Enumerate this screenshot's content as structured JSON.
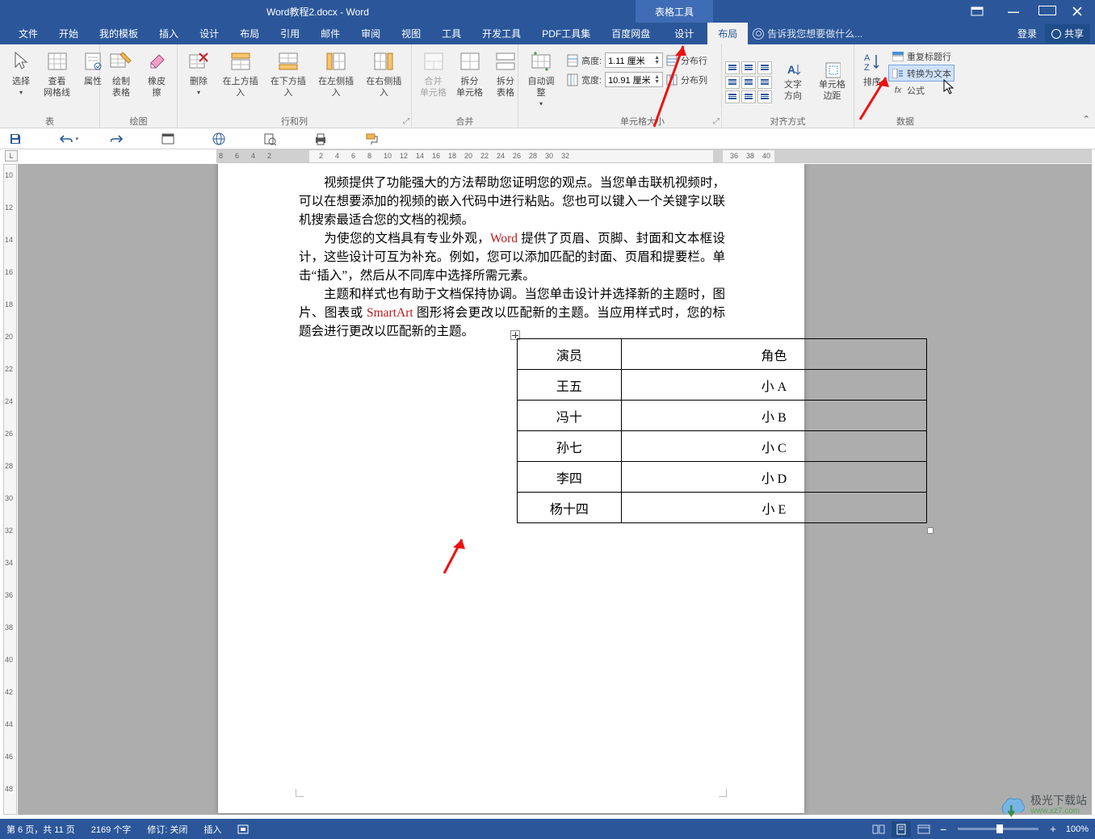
{
  "title_bar": {
    "doc_title": "Word教程2.docx - Word",
    "table_tools": "表格工具"
  },
  "tabs": {
    "items": [
      "文件",
      "开始",
      "我的模板",
      "插入",
      "设计",
      "布局",
      "引用",
      "邮件",
      "审阅",
      "视图",
      "工具",
      "开发工具",
      "PDF工具集",
      "百度网盘",
      "设计",
      "布局"
    ],
    "tellme": "告诉我您想要做什么...",
    "login": "登录",
    "share": "共享"
  },
  "ribbon": {
    "groups": {
      "table": {
        "label": "表",
        "select": "选择",
        "gridlines": "查看\n网格线",
        "props": "属性"
      },
      "draw": {
        "label": "绘图",
        "draw": "绘制表格",
        "eraser": "橡皮擦"
      },
      "rowscols": {
        "label": "行和列",
        "delete": "删除",
        "above": "在上方插入",
        "below": "在下方插入",
        "left": "在左侧插入",
        "right": "在右侧插入"
      },
      "merge": {
        "label": "合并",
        "mergec": "合并\n单元格",
        "splitc": "拆分\n单元格",
        "splitt": "拆分表格"
      },
      "autofit": {
        "label": "",
        "auto": "自动调整"
      },
      "cellsize": {
        "label": "单元格大小",
        "hlabel": "高度:",
        "hval": "1.11 厘米",
        "wlabel": "宽度:",
        "wval": "10.91 厘米",
        "distrows": "分布行",
        "distcols": "分布列"
      },
      "align": {
        "label": "对齐方式",
        "textdir": "文字方向",
        "margins": "单元格\n边距"
      },
      "data": {
        "label": "数据",
        "sort": "排序",
        "repeat": "重复标题行",
        "convert": "转换为文本",
        "formula": "公式"
      }
    },
    "collapse": "⌃"
  },
  "ruler_corner": "L",
  "h_ruler_labels": [
    "8",
    "6",
    "4",
    "2",
    "2",
    "4",
    "6",
    "8",
    "10",
    "12",
    "14",
    "16",
    "18",
    "20",
    "22",
    "24",
    "26",
    "28",
    "30",
    "32",
    "36",
    "38",
    "40"
  ],
  "v_ruler_labels": [
    "10",
    "12",
    "14",
    "16",
    "18",
    "20",
    "22",
    "24",
    "26",
    "28",
    "30",
    "32",
    "34",
    "36",
    "38",
    "40",
    "42",
    "44",
    "46",
    "48"
  ],
  "doc": {
    "p1_part1": "视频提供了功能强大的方法帮助您证明您的观点。当您单击联机视频时，可以在想要添加的视频的嵌入代码中进行粘贴。您也可以键入一个关键字以联机搜索最适合您的文档的视频。",
    "p2_pre": "为使您的文档具有专业外观，",
    "p2_word": "Word",
    "p2_post": " 提供了页眉、页脚、封面和文本框设计，这些设计可互为补充。例如，您可以添加匹配的封面、页眉和提要栏。单击“插入”，然后从不同库中选择所需元素。",
    "p3_pre": "主题和样式也有助于文档保持协调。当您单击设计并选择新的主题时，图片、图表或 ",
    "p3_sa": "SmartArt",
    "p3_post": " 图形将会更改以匹配新的主题。当应用样式时，您的标题会进行更改以匹配新的主题。",
    "table_rows": [
      {
        "c1": "演员",
        "c2": "角色"
      },
      {
        "c1": "王五",
        "c2": "小 A"
      },
      {
        "c1": "冯十",
        "c2": "小 B"
      },
      {
        "c1": "孙七",
        "c2": "小 C"
      },
      {
        "c1": "李四",
        "c2": "小 D"
      },
      {
        "c1": "杨十四",
        "c2": "小 E"
      }
    ]
  },
  "status": {
    "page": "第 6 页，共 11 页",
    "words": "2169 个字",
    "track": "修订: 关闭",
    "mode": "插入",
    "zoom": "100%"
  },
  "watermark": {
    "name": "极光下载站",
    "url": "www.xz7.com"
  }
}
